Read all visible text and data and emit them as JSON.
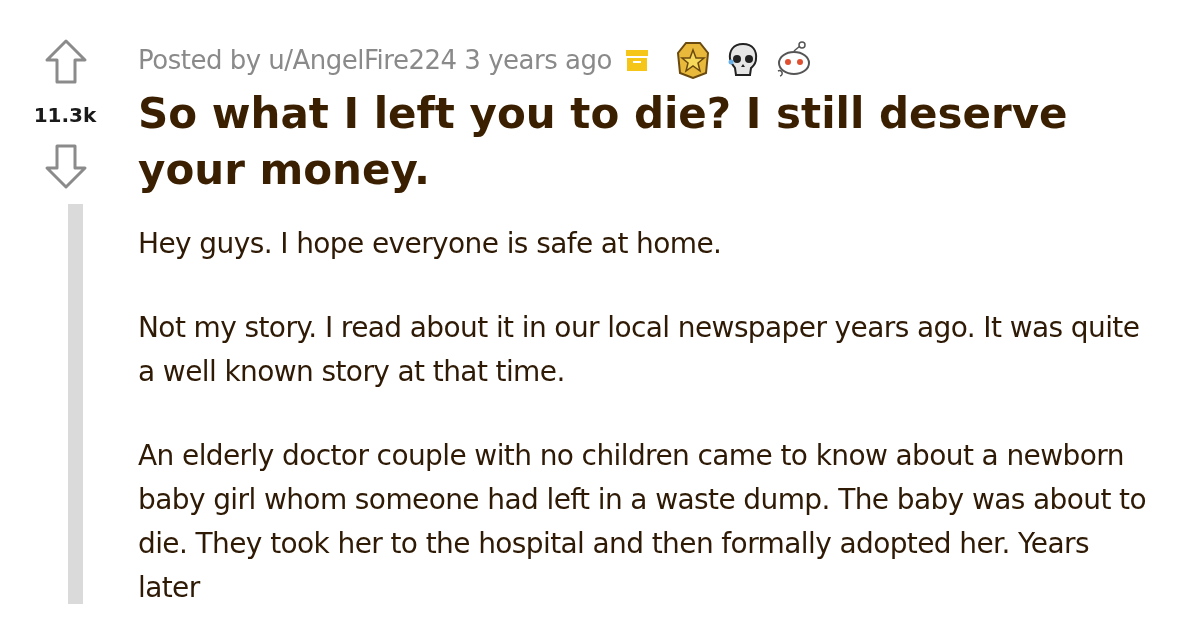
{
  "post": {
    "meta": "Posted by u/AngelFire224 3 years ago",
    "score": "11.3k",
    "title": "So what I left you to die? I still deserve your money.",
    "paragraphs": [
      "Hey guys. I hope everyone is safe at home.",
      "Not my story. I read about it in our local newspaper years ago. It was quite a well known story at that time.",
      "An elderly doctor couple with no children came to know about a newborn baby girl whom someone had left in a waste dump. The baby was about to die. They took her to the hospital and then formally adopted her. Years later"
    ]
  }
}
